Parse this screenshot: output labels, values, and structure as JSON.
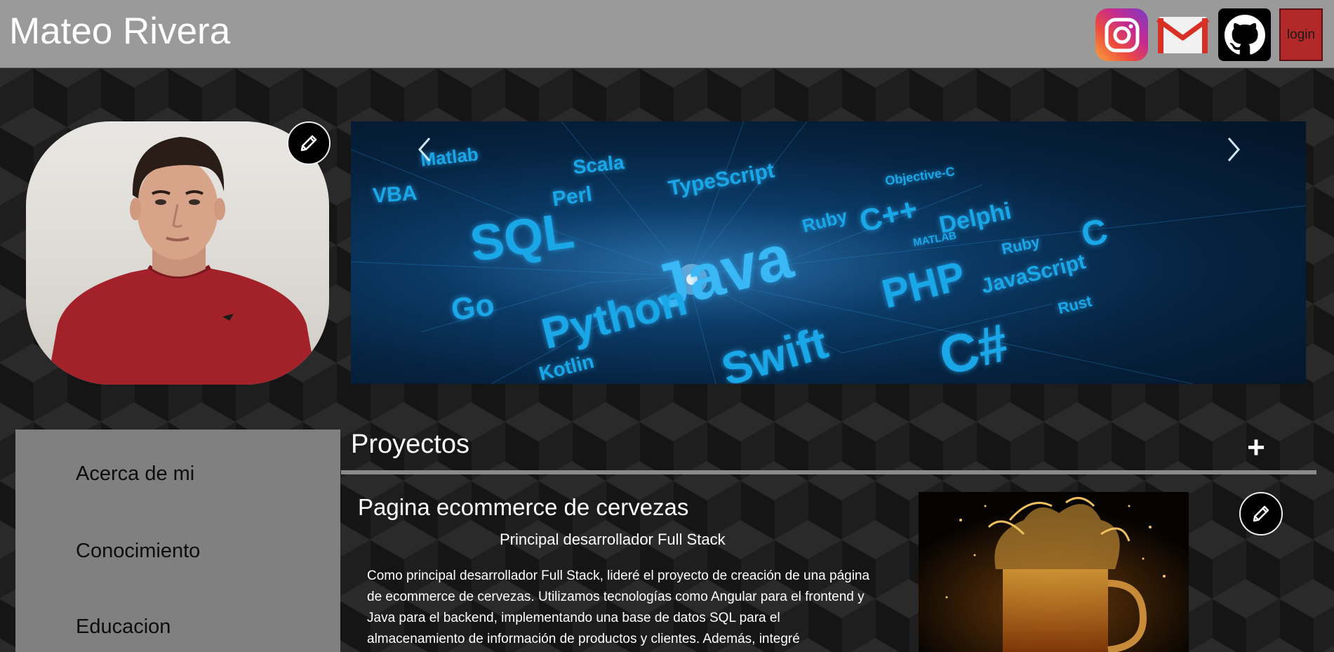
{
  "header": {
    "title": "Mateo Rivera",
    "login_label": "login",
    "social": [
      {
        "icon": "instagram-icon"
      },
      {
        "icon": "gmail-icon"
      },
      {
        "icon": "github-icon"
      }
    ]
  },
  "profile": {
    "edit_icon": "pencil-icon"
  },
  "banner": {
    "languages": [
      "Matlab",
      "Scala",
      "VBA",
      "Perl",
      "TypeScript",
      "Objective-C",
      "SQL",
      "Ruby",
      "C++",
      "Delphi",
      "Java",
      "MATLAB",
      "Ruby",
      "C",
      "Go",
      "PHP",
      "JavaScript",
      "Python",
      "Rust",
      "Swift",
      "C#",
      "Kotlin"
    ]
  },
  "sidebar": {
    "items": [
      {
        "label": "Acerca de mi"
      },
      {
        "label": "Conocimiento"
      },
      {
        "label": "Educacion"
      }
    ]
  },
  "projects": {
    "heading": "Proyectos",
    "add_label": "+",
    "cards": [
      {
        "title": "Pagina ecommerce de cervezas",
        "role": "Principal desarrollador Full Stack",
        "description": "Como principal desarrollador Full Stack, lideré el proyecto de creación de una página de ecommerce de cervezas. Utilizamos tecnologías como Angular para el frontend y Java para el backend, implementando una base de datos SQL para el almacenamiento de información de productos y clientes. Además, integré"
      }
    ]
  },
  "colors": {
    "header_bg": "#9a9a9a",
    "login_bg": "#b32828",
    "sidebar_bg": "#808080",
    "divider": "#8a8a8a"
  }
}
